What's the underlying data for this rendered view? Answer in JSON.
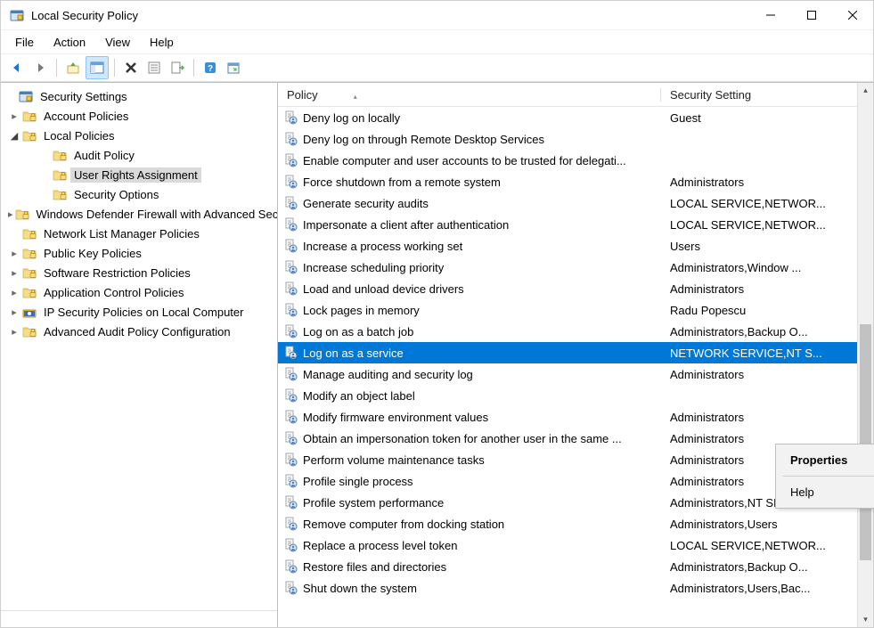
{
  "window": {
    "title": "Local Security Policy"
  },
  "menu": {
    "file": "File",
    "action": "Action",
    "view": "View",
    "help": "Help"
  },
  "tree": {
    "root": {
      "label": "Security Settings"
    },
    "items": [
      {
        "label": "Account Policies",
        "expand": ">"
      },
      {
        "label": "Local Policies",
        "expand": "v",
        "children": [
          {
            "label": "Audit Policy"
          },
          {
            "label": "User Rights Assignment",
            "selected": true
          },
          {
            "label": "Security Options"
          }
        ]
      },
      {
        "label": "Windows Defender Firewall with Advanced Security",
        "expand": ">"
      },
      {
        "label": "Network List Manager Policies"
      },
      {
        "label": "Public Key Policies",
        "expand": ">"
      },
      {
        "label": "Software Restriction Policies",
        "expand": ">"
      },
      {
        "label": "Application Control Policies",
        "expand": ">"
      },
      {
        "label": "IP Security Policies on Local Computer",
        "expand": ">",
        "icon": "ipsec"
      },
      {
        "label": "Advanced Audit Policy Configuration",
        "expand": ">"
      }
    ]
  },
  "columns": {
    "policy": "Policy",
    "setting": "Security Setting"
  },
  "policies": [
    {
      "policy": "Deny log on locally",
      "setting": "Guest"
    },
    {
      "policy": "Deny log on through Remote Desktop Services",
      "setting": ""
    },
    {
      "policy": "Enable computer and user accounts to be trusted for delegati...",
      "setting": ""
    },
    {
      "policy": "Force shutdown from a remote system",
      "setting": "Administrators"
    },
    {
      "policy": "Generate security audits",
      "setting": "LOCAL SERVICE,NETWOR..."
    },
    {
      "policy": "Impersonate a client after authentication",
      "setting": "LOCAL SERVICE,NETWOR..."
    },
    {
      "policy": "Increase a process working set",
      "setting": "Users"
    },
    {
      "policy": "Increase scheduling priority",
      "setting": "Administrators,Window ..."
    },
    {
      "policy": "Load and unload device drivers",
      "setting": "Administrators"
    },
    {
      "policy": "Lock pages in memory",
      "setting": "Radu Popescu"
    },
    {
      "policy": "Log on as a batch job",
      "setting": "Administrators,Backup O..."
    },
    {
      "policy": "Log on as a service",
      "setting": "NETWORK SERVICE,NT S...",
      "selected": true
    },
    {
      "policy": "Manage auditing and security log",
      "setting": "Administrators"
    },
    {
      "policy": "Modify an object label",
      "setting": ""
    },
    {
      "policy": "Modify firmware environment values",
      "setting": "Administrators"
    },
    {
      "policy": "Obtain an impersonation token for another user in the same ...",
      "setting": "Administrators"
    },
    {
      "policy": "Perform volume maintenance tasks",
      "setting": "Administrators"
    },
    {
      "policy": "Profile single process",
      "setting": "Administrators"
    },
    {
      "policy": "Profile system performance",
      "setting": "Administrators,NT SERVI..."
    },
    {
      "policy": "Remove computer from docking station",
      "setting": "Administrators,Users"
    },
    {
      "policy": "Replace a process level token",
      "setting": "LOCAL SERVICE,NETWOR..."
    },
    {
      "policy": "Restore files and directories",
      "setting": "Administrators,Backup O..."
    },
    {
      "policy": "Shut down the system",
      "setting": "Administrators,Users,Bac..."
    }
  ],
  "context_menu": {
    "properties": "Properties",
    "help": "Help"
  }
}
